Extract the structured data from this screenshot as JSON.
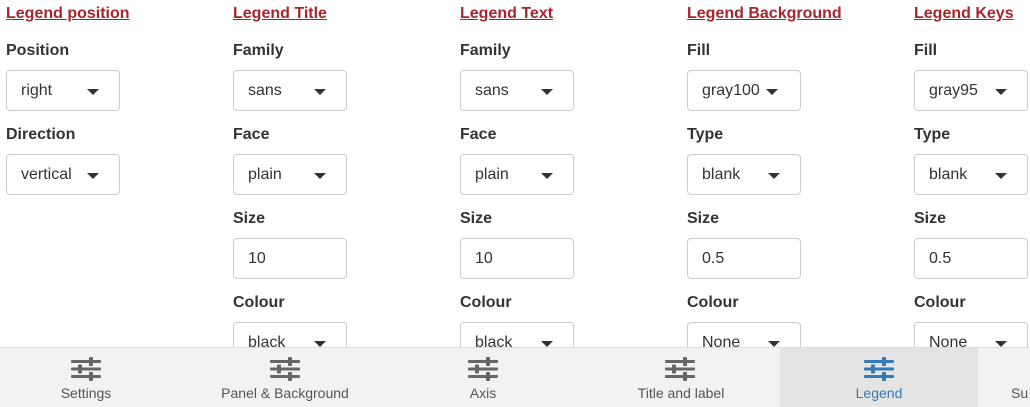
{
  "sections": {
    "legend_position": {
      "title": "Legend position",
      "position_label": "Position",
      "position_value": "right",
      "direction_label": "Direction",
      "direction_value": "vertical"
    },
    "legend_title": {
      "title": "Legend Title",
      "family_label": "Family",
      "family_value": "sans",
      "face_label": "Face",
      "face_value": "plain",
      "size_label": "Size",
      "size_value": "10",
      "colour_label": "Colour",
      "colour_value": "black"
    },
    "legend_text": {
      "title": "Legend Text",
      "family_label": "Family",
      "family_value": "sans",
      "face_label": "Face",
      "face_value": "plain",
      "size_label": "Size",
      "size_value": "10",
      "colour_label": "Colour",
      "colour_value": "black"
    },
    "legend_background": {
      "title": "Legend Background",
      "fill_label": "Fill",
      "fill_value": "gray100",
      "type_label": "Type",
      "type_value": "blank",
      "size_label": "Size",
      "size_value": "0.5",
      "colour_label": "Colour",
      "colour_value": "None"
    },
    "legend_keys": {
      "title": "Legend Keys",
      "fill_label": "Fill",
      "fill_value": "gray95",
      "type_label": "Type",
      "type_value": "blank",
      "size_label": "Size",
      "size_value": "0.5",
      "colour_label": "Colour",
      "colour_value": "None"
    }
  },
  "tabs": [
    {
      "label": "Settings",
      "icon": "sliders-icon"
    },
    {
      "label": "Panel & Background",
      "icon": "sliders-icon"
    },
    {
      "label": "Axis",
      "icon": "sliders-icon"
    },
    {
      "label": "Title and label",
      "icon": "sliders-icon"
    },
    {
      "label": "Legend",
      "icon": "sliders-icon",
      "active": true
    },
    {
      "label": "Su",
      "icon": "sliders-icon"
    }
  ],
  "colors": {
    "section_title": "#a5262c",
    "active_tab": "#337ab7",
    "inactive_icon": "#666666"
  }
}
